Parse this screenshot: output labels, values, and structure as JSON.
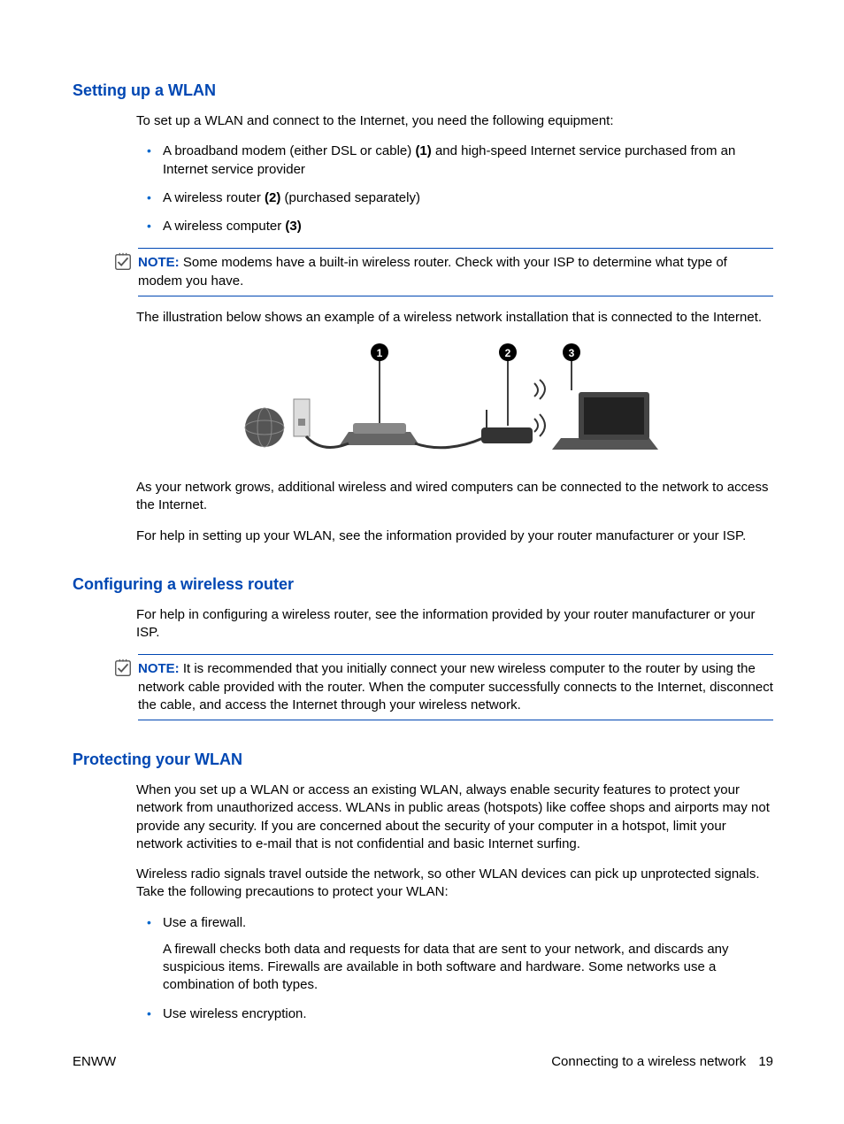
{
  "sections": {
    "wlan": {
      "heading": "Setting up a WLAN",
      "intro": "To set up a WLAN and connect to the Internet, you need the following equipment:",
      "items": [
        {
          "pre": "A broadband modem (either DSL or cable) ",
          "bold": "(1)",
          "post": " and high-speed Internet service purchased from an Internet service provider"
        },
        {
          "pre": "A wireless router ",
          "bold": "(2)",
          "post": " (purchased separately)"
        },
        {
          "pre": "A wireless computer ",
          "bold": "(3)",
          "post": ""
        }
      ],
      "note_label": "NOTE:",
      "note_text": "Some modems have a built-in wireless router. Check with your ISP to determine what type of modem you have.",
      "illustration_intro": "The illustration below shows an example of a wireless network installation that is connected to the Internet.",
      "grow_text": "As your network grows, additional wireless and wired computers can be connected to the network to access the Internet.",
      "help_text": "For help in setting up your WLAN, see the information provided by your router manufacturer or your ISP."
    },
    "router": {
      "heading": "Configuring a wireless router",
      "intro": "For help in configuring a wireless router, see the information provided by your router manufacturer or your ISP.",
      "note_label": "NOTE:",
      "note_text": "It is recommended that you initially connect your new wireless computer to the router by using the network cable provided with the router. When the computer successfully connects to the Internet, disconnect the cable, and access the Internet through your wireless network."
    },
    "protect": {
      "heading": "Protecting your WLAN",
      "p1": "When you set up a WLAN or access an existing WLAN, always enable security features to protect your network from unauthorized access. WLANs in public areas (hotspots) like coffee shops and airports may not provide any security. If you are concerned about the security of your computer in a hotspot, limit your network activities to e-mail that is not confidential and basic Internet surfing.",
      "p2": "Wireless radio signals travel outside the network, so other WLAN devices can pick up unprotected signals. Take the following precautions to protect your WLAN:",
      "items": [
        {
          "title": "Use a firewall.",
          "desc": "A firewall checks both data and requests for data that are sent to your network, and discards any suspicious items. Firewalls are available in both software and hardware. Some networks use a combination of both types."
        },
        {
          "title": "Use wireless encryption.",
          "desc": ""
        }
      ]
    }
  },
  "footer": {
    "left": "ENWW",
    "right": "Connecting to a wireless network",
    "page": "19"
  }
}
